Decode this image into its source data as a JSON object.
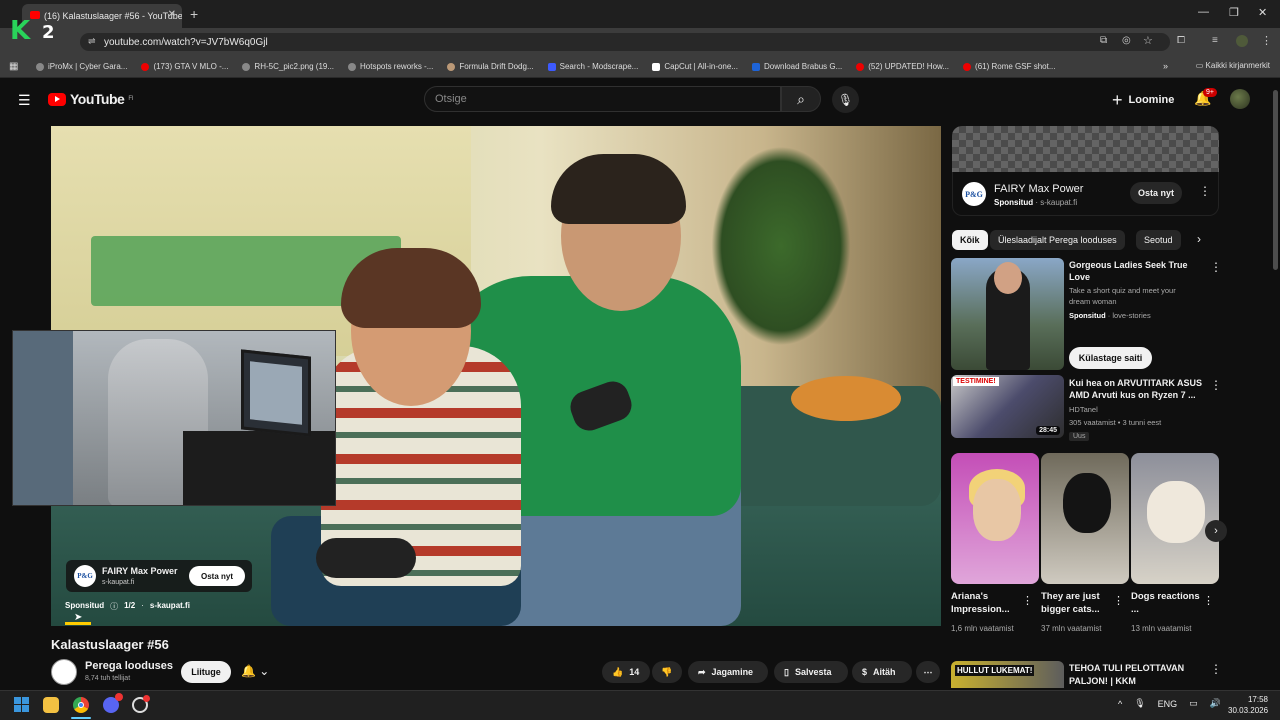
{
  "browser": {
    "tab_title": "(16) Kalastuslaager #56 - YouTube",
    "url": "youtube.com/watch?v=JV7bW6q0Gjl",
    "bookmarks": [
      "iProMx | Cyber Gara...",
      "(173) GTA V MLO -...",
      "RH-5C_pic2.png (19...",
      "Hotspots reworks -...",
      "Formula Drift Dodg...",
      "Search - Modscrape...",
      "CapCut | All-in-one...",
      "Download Brabus G...",
      "(52) UPDATED! How...",
      "(61) Rome GSF shot..."
    ],
    "all_bookmarks": "Kaikki kirjanmerkit"
  },
  "overlay_logo": {
    "k": "K",
    "num": "2"
  },
  "youtube": {
    "logo_text": "YouTube",
    "logo_region": "FI",
    "search_placeholder": "Otsige",
    "create_label": "Loomine",
    "notif_count": "9+"
  },
  "video_ad": {
    "advertiser": "FAIRY Max Power",
    "domain": "s-kaupat.fi",
    "cta": "Osta nyt",
    "logo_text": "P&G",
    "sponsored": "Sponsitud",
    "ad_count": "1/2",
    "ad_domain": "s-kaupat.fi",
    "progress_fraction": 0.03
  },
  "video": {
    "title": "Kalastuslaager #56",
    "channel": "Perega looduses",
    "subscribers": "8,74 tuh tellijat",
    "join_label": "Liituge",
    "likes": "14",
    "share_label": "Jagamine",
    "save_label": "Salvesta",
    "clip_label": "Aitäh"
  },
  "sidebar_ad": {
    "logo_text": "P&G",
    "title": "FAIRY Max Power",
    "sponsored": "Sponsitud",
    "domain": "s-kaupat.fi",
    "cta": "Osta nyt"
  },
  "chips": [
    "Kõik",
    "Üleslaadijalt Perega looduses",
    "Seotud"
  ],
  "recommendations": [
    {
      "title": "Gorgeous Ladies Seek True Love",
      "description": "Take a short quiz and meet your dream woman",
      "sponsored": "Sponsitud",
      "advertiser": "love-stories",
      "cta": "Külastage saiti"
    },
    {
      "title": "Kui hea on ARVUTITARK ASUS AMD Arvuti kus on Ryzen 7 ...",
      "channel": "HDTanel",
      "meta": "305 vaatamist • 3 tunni eest",
      "badge": "Uus",
      "duration": "28:45",
      "thumb_tag": "TESTIMINE!"
    }
  ],
  "shorts": [
    {
      "title": "Ariana's Impression...",
      "views": "1,6 mln vaatamist"
    },
    {
      "title": "They are just bigger cats...",
      "views": "37 mln vaatamist"
    },
    {
      "title": "Dogs reactions ...",
      "views": "13 mln vaatamist"
    }
  ],
  "rec_bottom": {
    "title": "TEHOA TULI PELOTTAVAN PALJON! | KKM",
    "thumb_text": "HULLUT LUKEMAT!"
  },
  "taskbar": {
    "lang": "ENG",
    "time": "17:58",
    "date": "30.03.2026"
  }
}
